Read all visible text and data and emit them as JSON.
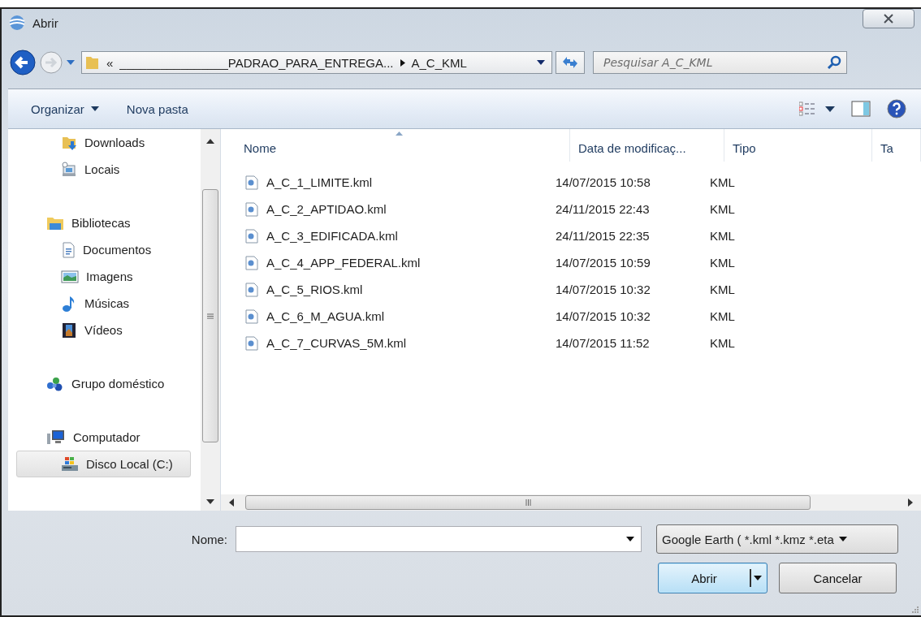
{
  "window": {
    "title": "Abrir"
  },
  "address": {
    "overflow": "«",
    "path": [
      "________________PADRAO_PARA_ENTREGA...",
      "A_C_KML"
    ]
  },
  "search": {
    "placeholder": "Pesquisar A_C_KML"
  },
  "toolbar": [
    {
      "label": "Organizar",
      "menu": true
    },
    {
      "label": "Nova pasta",
      "menu": false
    }
  ],
  "sidebar": {
    "sections": [
      {
        "children": [
          {
            "label": "Downloads",
            "kind": "downloads",
            "selected": false
          },
          {
            "label": "Locais",
            "kind": "recent",
            "selected": false
          }
        ]
      },
      {
        "label": "Bibliotecas",
        "kind": "library",
        "selected": false,
        "children": [
          {
            "label": "Documentos",
            "kind": "document",
            "selected": false
          },
          {
            "label": "Imagens",
            "kind": "pictures",
            "selected": false
          },
          {
            "label": "Músicas",
            "kind": "music",
            "selected": false
          },
          {
            "label": "Vídeos",
            "kind": "videos",
            "selected": false
          }
        ]
      },
      {
        "label": "Grupo doméstico",
        "kind": "homegroup",
        "selected": false
      },
      {
        "label": "Computador",
        "kind": "computer",
        "selected": false,
        "children": [
          {
            "label": "Disco Local (C:)",
            "kind": "drive",
            "selected": true
          }
        ]
      }
    ]
  },
  "columns": [
    {
      "label": "Nome",
      "sorted": true
    },
    {
      "label": "Data de modificaç...",
      "sorted": false
    },
    {
      "label": "Tipo",
      "sorted": false
    },
    {
      "label": "Ta",
      "sorted": false
    }
  ],
  "files": [
    {
      "name": "A_C_1_LIMITE.kml",
      "modified": "14/07/2015 10:58",
      "type": "KML"
    },
    {
      "name": "A_C_2_APTIDAO.kml",
      "modified": "24/11/2015 22:43",
      "type": "KML"
    },
    {
      "name": "A_C_3_EDIFICADA.kml",
      "modified": "24/11/2015 22:35",
      "type": "KML"
    },
    {
      "name": "A_C_4_APP_FEDERAL.kml",
      "modified": "14/07/2015 10:59",
      "type": "KML"
    },
    {
      "name": "A_C_5_RIOS.kml",
      "modified": "14/07/2015 10:32",
      "type": "KML"
    },
    {
      "name": "A_C_6_M_AGUA.kml",
      "modified": "14/07/2015 10:32",
      "type": "KML"
    },
    {
      "name": "A_C_7_CURVAS_5M.kml",
      "modified": "14/07/2015 11:52",
      "type": "KML"
    }
  ],
  "file_name": {
    "label": "Nome:"
  },
  "file_type": {
    "value": "Google Earth ( *.kml *.kmz *.eta"
  },
  "buttons": [
    {
      "label": "Abrir",
      "default": true
    },
    {
      "label": "Cancelar",
      "default": false
    }
  ]
}
